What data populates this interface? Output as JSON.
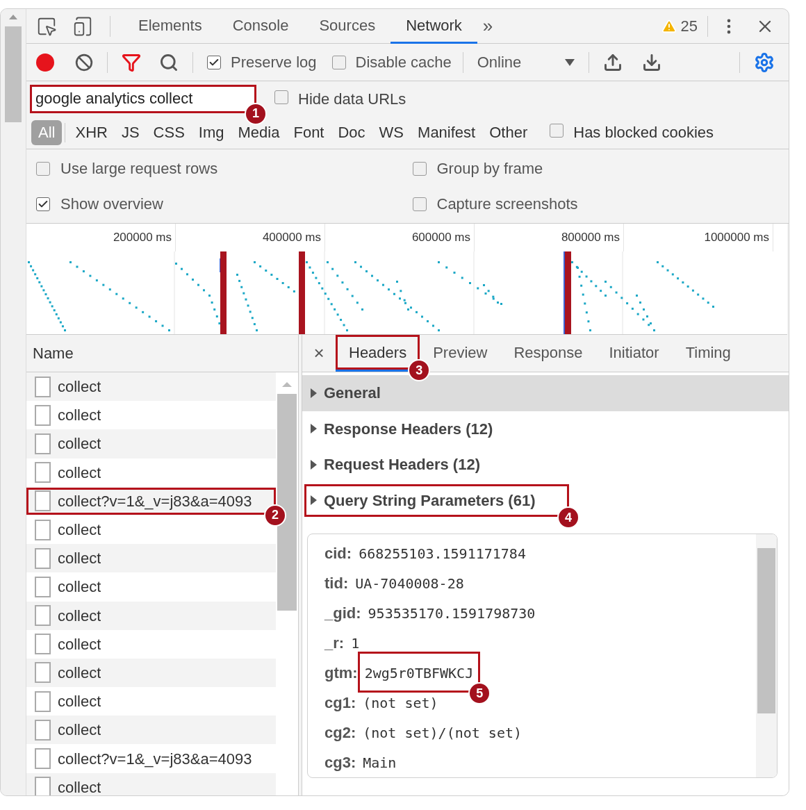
{
  "tabs": [
    {
      "label": "Elements",
      "selected": false
    },
    {
      "label": "Console",
      "selected": false
    },
    {
      "label": "Sources",
      "selected": false
    },
    {
      "label": "Network",
      "selected": true
    }
  ],
  "more_tabs": "»",
  "warnings": "25",
  "toolbar": {
    "recording": true,
    "filter_on": true,
    "preserve_log": {
      "label": "Preserve log",
      "checked": true
    },
    "disable_cache": {
      "label": "Disable cache",
      "checked": false
    },
    "throttling": "Online"
  },
  "filter": {
    "value": "google analytics collect",
    "callout": "1"
  },
  "hide_data_urls": {
    "label": "Hide data URLs",
    "checked": false
  },
  "types": [
    {
      "label": "All",
      "selected": true
    },
    {
      "label": "XHR",
      "selected": false
    },
    {
      "label": "JS",
      "selected": false
    },
    {
      "label": "CSS",
      "selected": false
    },
    {
      "label": "Img",
      "selected": false
    },
    {
      "label": "Media",
      "selected": false
    },
    {
      "label": "Font",
      "selected": false
    },
    {
      "label": "Doc",
      "selected": false
    },
    {
      "label": "WS",
      "selected": false
    },
    {
      "label": "Manifest",
      "selected": false
    },
    {
      "label": "Other",
      "selected": false
    }
  ],
  "has_blocked_cookies": {
    "label": "Has blocked cookies",
    "checked": false
  },
  "settings": [
    {
      "label": "Use large request rows",
      "checked": false
    },
    {
      "label": "Group by frame",
      "checked": false
    },
    {
      "label": "Show overview",
      "checked": true
    },
    {
      "label": "Capture screenshots",
      "checked": false
    }
  ],
  "overview": {
    "ticks": [
      "200000 ms",
      "400000 ms",
      "600000 ms",
      "800000 ms",
      "1000000 ms"
    ]
  },
  "requests": {
    "column": "Name",
    "rows": [
      {
        "name": "collect"
      },
      {
        "name": "collect"
      },
      {
        "name": "collect"
      },
      {
        "name": "collect"
      },
      {
        "name": "collect?v=1&_v=j83&a=4093",
        "callout": "2"
      },
      {
        "name": "collect"
      },
      {
        "name": "collect"
      },
      {
        "name": "collect"
      },
      {
        "name": "collect"
      },
      {
        "name": "collect"
      },
      {
        "name": "collect"
      },
      {
        "name": "collect"
      },
      {
        "name": "collect"
      },
      {
        "name": "collect?v=1&_v=j83&a=4093"
      },
      {
        "name": "collect"
      }
    ]
  },
  "details": {
    "close": "×",
    "tabs": [
      {
        "label": "Headers",
        "selected": true,
        "callout": "3"
      },
      {
        "label": "Preview",
        "selected": false
      },
      {
        "label": "Response",
        "selected": false
      },
      {
        "label": "Initiator",
        "selected": false
      },
      {
        "label": "Timing",
        "selected": false
      }
    ],
    "sections": [
      {
        "title": "General",
        "selected": true
      },
      {
        "title": "Response Headers (12)",
        "selected": false
      },
      {
        "title": "Request Headers (12)",
        "selected": false
      },
      {
        "title": "Query String Parameters (61)",
        "selected": false,
        "callout": "4"
      }
    ],
    "params": [
      {
        "key": "cid:",
        "value": "668255103.1591171784"
      },
      {
        "key": "tid:",
        "value": "UA-7040008-28"
      },
      {
        "key": "_gid:",
        "value": "953535170.1591798730"
      },
      {
        "key": "_r:",
        "value": "1"
      },
      {
        "key": "gtm:",
        "value": "2wg5r0TBFWKCJ",
        "callout": "5"
      },
      {
        "key": "cg1:",
        "value": "(not set)"
      },
      {
        "key": "cg2:",
        "value": "(not set)/(not set)"
      },
      {
        "key": "cg3:",
        "value": "Main"
      }
    ]
  }
}
